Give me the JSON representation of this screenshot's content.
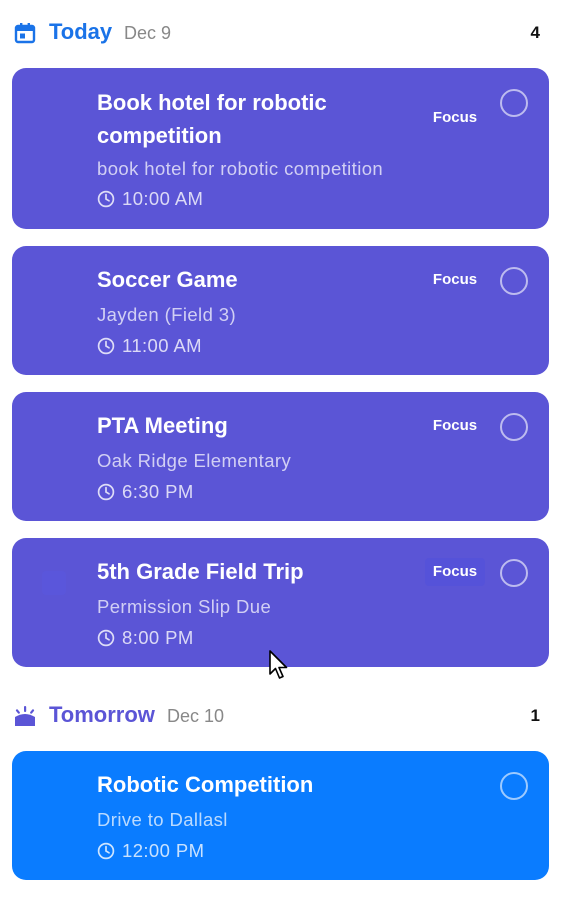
{
  "colors": {
    "today_accent": "#1a73e8",
    "tomorrow_accent": "#5b55d6",
    "card_purple": "#5b55d6",
    "card_blue": "#0a7cff",
    "muted_text": "#888888"
  },
  "today": {
    "icon": "calendar-icon",
    "title": "Today",
    "date": "Dec 9",
    "count": "4",
    "tasks": [
      {
        "title": "Book hotel for robotic competition",
        "subtitle": "book hotel for robotic competition",
        "time": "10:00 AM",
        "focus": "Focus",
        "completed": false
      },
      {
        "title": "Soccer Game",
        "subtitle": "Jayden (Field 3)",
        "time": "11:00 AM",
        "focus": "Focus",
        "completed": false
      },
      {
        "title": "PTA Meeting",
        "subtitle": "Oak Ridge Elementary",
        "time": "6:30 PM",
        "focus": "Focus",
        "completed": false
      },
      {
        "title": "5th Grade Field Trip",
        "subtitle": "Permission Slip Due",
        "time": "8:00 PM",
        "focus": "Focus",
        "completed": false
      }
    ]
  },
  "tomorrow": {
    "icon": "sunrise-icon",
    "title": "Tomorrow",
    "date": "Dec 10",
    "count": "1",
    "tasks": [
      {
        "title": "Robotic Competition",
        "subtitle": "Drive to Dallasl",
        "time": "12:00 PM",
        "completed": false
      }
    ]
  }
}
